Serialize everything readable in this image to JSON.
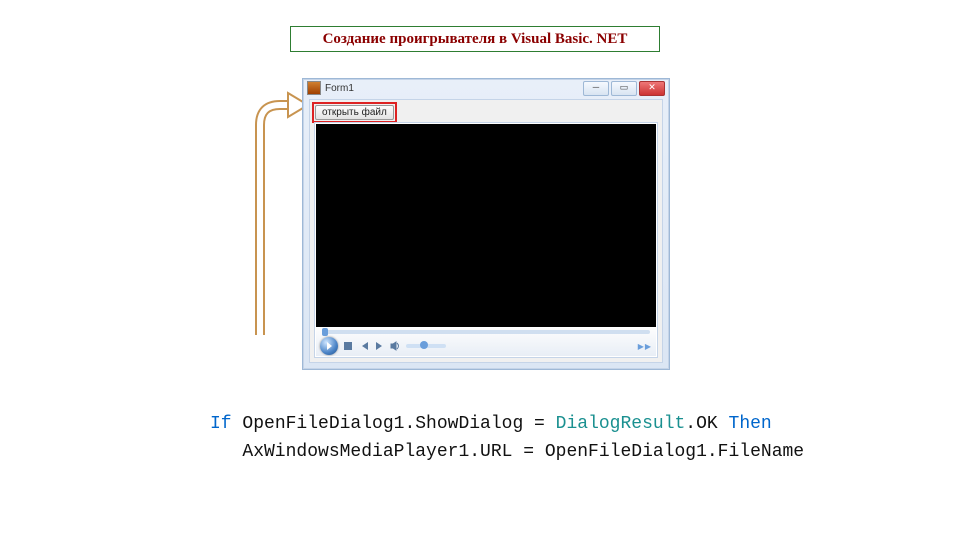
{
  "title": "Создание проигрывателя в Visual Basic. NET",
  "form": {
    "caption": "Form1",
    "open_button": "открыть файл",
    "player_status": "▶▶"
  },
  "code": {
    "kw_if": "If",
    "t1": " OpenFileDialog1.ShowDialog = ",
    "cls1": "DialogResult",
    "t2": ".OK ",
    "kw_then": "Then",
    "line2": "   AxWindowsMediaPlayer1.URL = OpenFileDialog1.FileName"
  }
}
